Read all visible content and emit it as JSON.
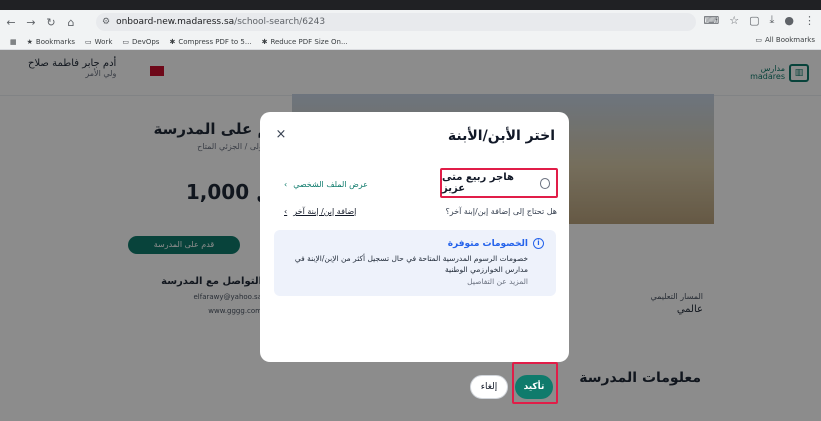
{
  "browser": {
    "url_host": "onboard-new.madaress.sa",
    "url_path": "/school-search/6243",
    "bookmarks": [
      "Bookmarks",
      "Work",
      "DevOps",
      "Compress PDF to 5...",
      "Reduce PDF Size On..."
    ],
    "all_bookmarks": "All Bookmarks"
  },
  "header": {
    "user_name": "أدم جابر فاطمة صلاح",
    "user_role": "ولي الأمر",
    "logo_ar": "مدارس",
    "logo_en": "madares"
  },
  "hero": {
    "title": "تقديم على المدرسة",
    "subtitle": "التسجيل الأولى / الجزئي المتاح",
    "price_label": "باب",
    "price": "1,000 ريال",
    "apply_button": "قدم على المدرسة",
    "contact_title": "التواصل مع المدرسة",
    "contact_email": "elfarawy@yahoo.sa",
    "contact_web": "www.gggg.com",
    "curriculum_label": "المسار التعليمي",
    "curriculum_value": "عالمي",
    "school_info": "معلومات المدرسة"
  },
  "modal": {
    "title": "اختر الأبن/الأبنة",
    "close": "×",
    "child_name": "هاجر ربيع متى عزيز",
    "view_profile": "عرض الملف الشخصي",
    "add_question": "هل تحتاج إلى إضافة إبن/إبنة آخر؟",
    "add_link": "إضافة إبن/ إبنة آخر",
    "discount_title": "الخصومات متوفرة",
    "discount_text": "خصومات الرسوم المدرسية المتاحة في حال تسجيل أكثر من الإبن/الإبنة في مدارس الخوارزمي الوطنية",
    "discount_more": "المزيد عن التفاصيل",
    "confirm": "تأكيد",
    "cancel": "إلغاء"
  }
}
